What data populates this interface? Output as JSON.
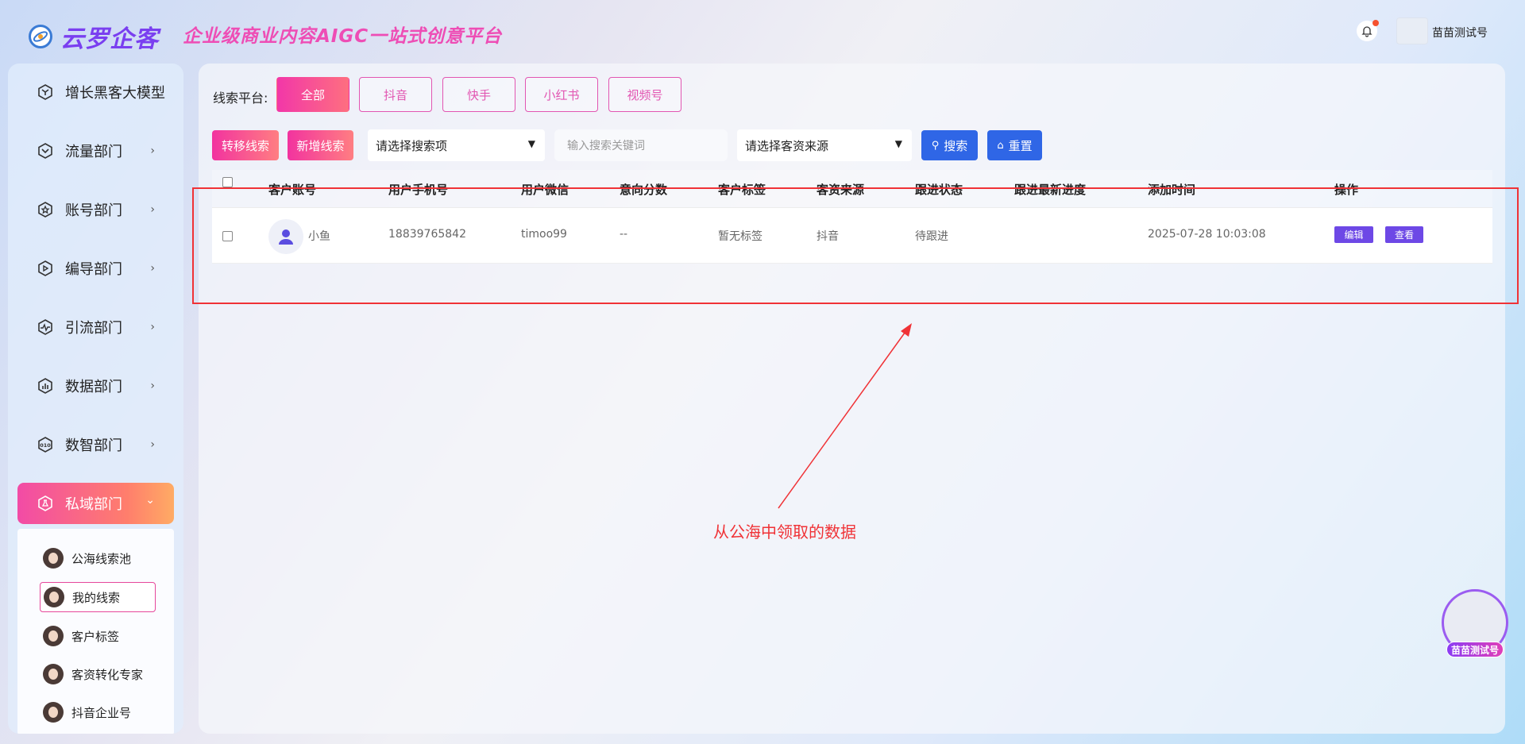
{
  "header": {
    "logo_text": "云罗企客",
    "slogan": "企业级商业内容AIGC一站式创意平台",
    "user_name": "苗苗测试号"
  },
  "sidebar": {
    "items": [
      {
        "label": "增长黑客大模型",
        "icon": "hexagon-icon"
      },
      {
        "label": "流量部门",
        "icon": "chevron-badge-icon"
      },
      {
        "label": "账号部门",
        "icon": "star-badge-icon"
      },
      {
        "label": "编导部门",
        "icon": "play-badge-icon"
      },
      {
        "label": "引流部门",
        "icon": "pulse-icon"
      },
      {
        "label": "数据部门",
        "icon": "bar-chart-icon"
      },
      {
        "label": "数智部门",
        "icon": "binary-icon"
      },
      {
        "label": "私域部门",
        "icon": "flask-icon"
      }
    ],
    "chevron": "›",
    "chevron_open": "⌄",
    "submenu": [
      {
        "label": "公海线索池"
      },
      {
        "label": "我的线索"
      },
      {
        "label": "客户标签"
      },
      {
        "label": "客资转化专家"
      },
      {
        "label": "抖音企业号"
      }
    ]
  },
  "filters": {
    "platform_label": "线索平台:",
    "platforms": [
      "全部",
      "抖音",
      "快手",
      "小红书",
      "视频号"
    ],
    "transfer_label": "转移线索",
    "add_label": "新增线索",
    "search_field_select": "请选择搜索项",
    "keyword_placeholder": "输入搜索关键词",
    "source_select": "请选择客资来源",
    "search_label": "搜索",
    "reset_label": "重置"
  },
  "table": {
    "columns": [
      "客户账号",
      "用户手机号",
      "用户微信",
      "意向分数",
      "客户标签",
      "客资来源",
      "跟进状态",
      "跟进最新进度",
      "添加时间",
      "操作"
    ],
    "rows": [
      {
        "account": "小鱼",
        "phone": "18839765842",
        "wechat": "timoo99",
        "score": "--",
        "tag": "暂无标签",
        "source": "抖音",
        "status": "待跟进",
        "progress": "",
        "added": "2025-07-28 10:03:08",
        "edit": "编辑",
        "view": "查看"
      }
    ]
  },
  "annotation": {
    "note": "从公海中领取的数据",
    "color": "#f03236"
  },
  "float_tag": "苗苗测试号",
  "colors": {
    "accent_pink": "#f24ba6",
    "primary_blue": "#2f66e6",
    "purple": "#6d48e6"
  }
}
